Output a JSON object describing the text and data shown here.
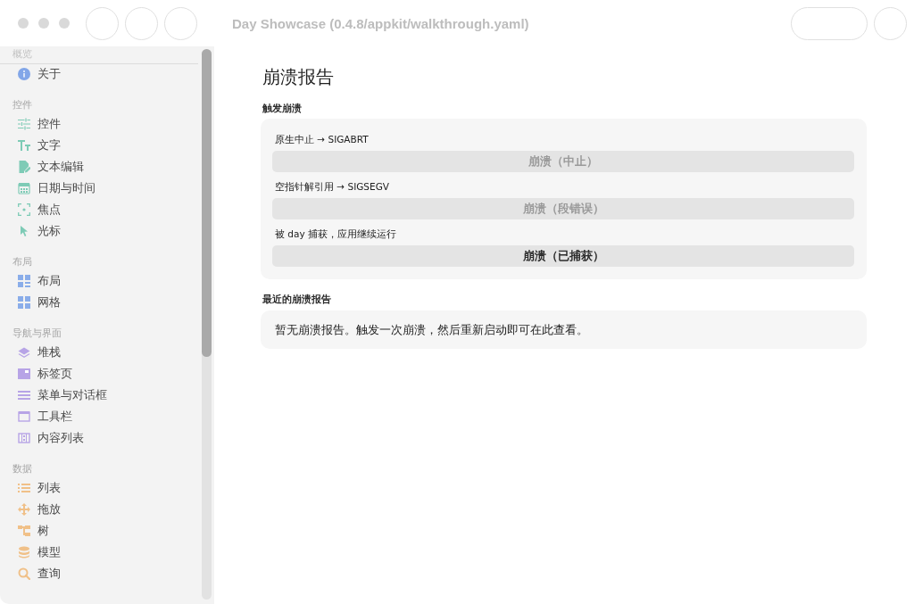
{
  "window": {
    "title": "Day Showcase (0.4.8/appkit/walkthrough.yaml)"
  },
  "toolbar": {
    "leading": [
      {
        "kind": "circle"
      },
      {
        "kind": "circle"
      },
      {
        "kind": "circle"
      }
    ],
    "trailing": [
      {
        "kind": "pill"
      },
      {
        "kind": "circle"
      }
    ]
  },
  "sidebar": {
    "sections": [
      {
        "title": "概览",
        "color": "#82a6e8",
        "items": [
          {
            "label": "关于",
            "selected": false
          }
        ]
      },
      {
        "title": "控件",
        "color": "#7ecbb6",
        "items": [
          {
            "label": "控件",
            "selected": false
          },
          {
            "label": "文字",
            "selected": false
          },
          {
            "label": "文本编辑",
            "selected": false
          },
          {
            "label": "日期与时间",
            "selected": false
          },
          {
            "label": "焦点",
            "selected": false
          },
          {
            "label": "光标",
            "selected": false
          }
        ]
      },
      {
        "title": "布局",
        "color": "#8aade9",
        "items": [
          {
            "label": "布局",
            "selected": false
          },
          {
            "label": "网格",
            "selected": false
          }
        ]
      },
      {
        "title": "导航与界面",
        "color": "#b7a4e6",
        "items": [
          {
            "label": "堆栈",
            "selected": false
          },
          {
            "label": "标签页",
            "selected": false
          },
          {
            "label": "菜单与对话框",
            "selected": false
          },
          {
            "label": "工具栏",
            "selected": false
          },
          {
            "label": "内容列表",
            "selected": false
          }
        ]
      },
      {
        "title": "数据",
        "color": "#f0c088",
        "items": [
          {
            "label": "列表",
            "selected": false
          },
          {
            "label": "拖放",
            "selected": false
          },
          {
            "label": "树",
            "selected": false
          },
          {
            "label": "模型",
            "selected": false
          },
          {
            "label": "查询",
            "selected": false
          }
        ]
      }
    ]
  },
  "page": {
    "title": "崩溃报告",
    "trigger": {
      "heading": "触发崩溃",
      "items": [
        {
          "description": "原生中止 → SIGABRT",
          "button": "崩溃（中止）",
          "disabled": true
        },
        {
          "description": "空指针解引用 → SIGSEGV",
          "button": "崩溃（段错误）",
          "disabled": true
        },
        {
          "description": "被 day 捕获，应用继续运行",
          "button": "崩溃（已捕获）",
          "disabled": false
        }
      ]
    },
    "recent": {
      "heading": "最近的崩溃报告",
      "message": "暂无崩溃报告。触发一次崩溃，然后重新启动即可在此查看。"
    }
  }
}
